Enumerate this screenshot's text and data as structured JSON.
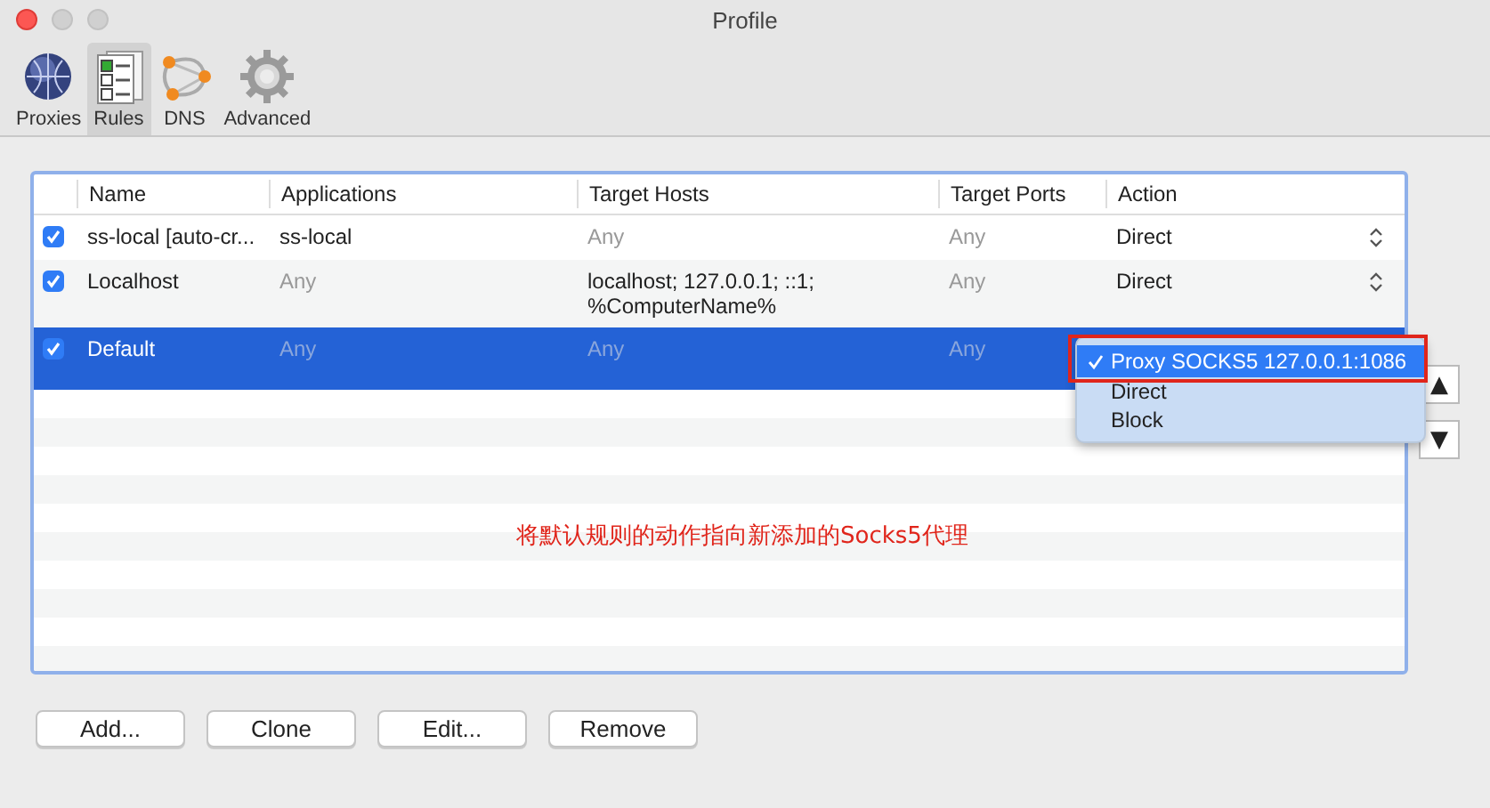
{
  "window": {
    "title": "Profile"
  },
  "toolbar": [
    {
      "label": "Proxies",
      "selected": false
    },
    {
      "label": "Rules",
      "selected": true
    },
    {
      "label": "DNS",
      "selected": false
    },
    {
      "label": "Advanced",
      "selected": false
    }
  ],
  "table": {
    "columns": [
      "Name",
      "Applications",
      "Target Hosts",
      "Target Ports",
      "Action"
    ],
    "rows": [
      {
        "checked": true,
        "selected": false,
        "cells": [
          {
            "text": "ss-local [auto-cr...",
            "muted": false
          },
          {
            "text": "ss-local",
            "muted": false
          },
          {
            "text": "Any",
            "muted": true
          },
          {
            "text": "Any",
            "muted": true
          }
        ],
        "action": "Direct"
      },
      {
        "checked": true,
        "selected": false,
        "cells": [
          {
            "text": "Localhost",
            "muted": false
          },
          {
            "text": "Any",
            "muted": true
          },
          {
            "text": "localhost; 127.0.0.1; ::1;\n%ComputerName%",
            "muted": false
          },
          {
            "text": "Any",
            "muted": true
          }
        ],
        "action": "Direct"
      },
      {
        "checked": true,
        "selected": true,
        "cells": [
          {
            "text": "Default",
            "muted": false
          },
          {
            "text": "Any",
            "muted": true
          },
          {
            "text": "Any",
            "muted": true
          },
          {
            "text": "Any",
            "muted": true
          }
        ]
      }
    ]
  },
  "action_menu": [
    {
      "label": "Proxy SOCKS5 127.0.0.1:1086",
      "selected": true
    },
    {
      "label": "Direct",
      "selected": false
    },
    {
      "label": "Block",
      "selected": false
    }
  ],
  "annotation": "将默认规则的动作指向新添加的Socks5代理",
  "move_buttons": [
    "▲",
    "▼"
  ],
  "buttons": [
    "Add...",
    "Clone",
    "Edit...",
    "Remove"
  ]
}
